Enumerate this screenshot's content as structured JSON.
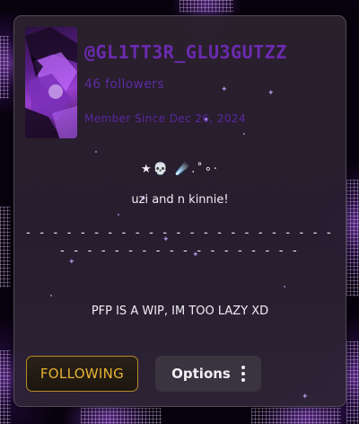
{
  "profile": {
    "username": "@GL1TT3R_GLU3GUTZZ",
    "followers": "46 followers",
    "member_since": "Member Since Dec 26, 2024"
  },
  "bio": {
    "emoji_line": "★💀 ☄️.˚∘·",
    "line1": "uzi and n kinnie!",
    "dashes": "- - - - - - - - - - - - - - - - - - - - - - - - - - - - - - - - - - - - - - - - -",
    "line2": "PFP IS A WIP, IM TOO LAZY XD"
  },
  "actions": {
    "following_label": "FOLLOWING",
    "options_label": "Options"
  },
  "colors": {
    "accent_purple": "#6b2bb0",
    "following_gold": "#e8b233",
    "card_bg": "#2c212e"
  },
  "icons": {
    "options": "vertical-ellipsis-icon"
  }
}
